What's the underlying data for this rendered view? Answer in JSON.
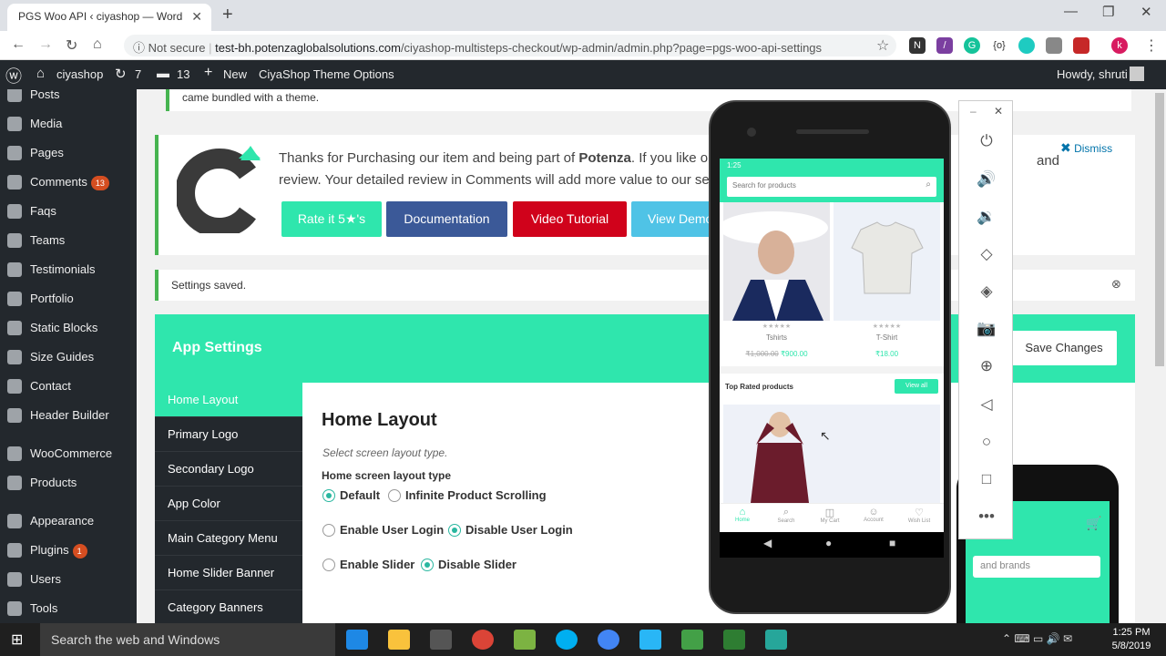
{
  "browser": {
    "tab_title": "PGS Woo API ‹ ciyashop — Word",
    "not_secure": "Not secure",
    "url_host": "test-bh.potenzaglobalsolutions.com",
    "url_path": "/ciyashop-multisteps-checkout/wp-admin/admin.php?page=pgs-woo-api-settings"
  },
  "adminbar": {
    "site": "ciyashop",
    "updates": "7",
    "comments": "13",
    "new": "New",
    "theme_options": "CiyaShop Theme Options",
    "howdy": "Howdy, shruti"
  },
  "sidebar": {
    "items": [
      {
        "label": "Posts"
      },
      {
        "label": "Media"
      },
      {
        "label": "Pages"
      },
      {
        "label": "Comments",
        "badge": "13"
      },
      {
        "label": "Faqs"
      },
      {
        "label": "Teams"
      },
      {
        "label": "Testimonials"
      },
      {
        "label": "Portfolio"
      },
      {
        "label": "Static Blocks"
      },
      {
        "label": "Size Guides"
      },
      {
        "label": "Contact"
      },
      {
        "label": "Header Builder"
      },
      {
        "label": "WooCommerce"
      },
      {
        "label": "Products"
      },
      {
        "label": "Appearance"
      },
      {
        "label": "Plugins",
        "badge": "1"
      },
      {
        "label": "Users"
      },
      {
        "label": "Tools"
      }
    ]
  },
  "notices": {
    "theme_bundle": "came bundled with a theme.",
    "thanks_pre": "Thanks for Purchasing our item and being part of",
    "thanks_brand": "Potenza",
    "thanks_post": ". If you like ou",
    "thanks_line2": "review. Your detailed review in Comments will add more value to our se",
    "thanks_and": "and",
    "dismiss": "Dismiss",
    "settings_saved": "Settings saved."
  },
  "buttons": {
    "rate": "Rate it 5★'s",
    "docs": "Documentation",
    "video": "Video Tutorial",
    "demo": "View Demo",
    "save": "Save Changes"
  },
  "app_settings": {
    "title": "App Settings",
    "menu": [
      "Home Layout",
      "Primary Logo",
      "Secondary Logo",
      "App Color",
      "Main Category Menu",
      "Home Slider Banner",
      "Category Banners"
    ],
    "panel_title": "Home Layout",
    "panel_desc": "Select screen layout type.",
    "field_label": "Home screen layout type",
    "options": {
      "default": "Default",
      "infinite": "Infinite Product Scrolling",
      "enable_login": "Enable User Login",
      "disable_login": "Disable User Login",
      "enable_slider": "Enable Slider",
      "disable_slider": "Disable Slider"
    }
  },
  "phone": {
    "time": "1:25",
    "search_placeholder": "Search for products",
    "p1_name": "Tshirts",
    "p1_old": "₹1,000.00",
    "p1_price": "₹900.00",
    "p2_name": "T-Shirt",
    "p2_price": "₹18.00",
    "top_rated": "Top Rated products",
    "view_all": "View all",
    "nav": [
      "Home",
      "Search",
      "My Cart",
      "Account",
      "Wish List"
    ],
    "bg_search": "and brands"
  },
  "taskbar": {
    "search": "Search the web and Windows",
    "time": "1:25 PM",
    "date": "5/8/2019"
  },
  "colors": {
    "accent": "#2fe6ad",
    "wp_dark": "#23282d",
    "docs": "#3b5998",
    "video": "#d0021b",
    "demo": "#4fc3e6"
  }
}
